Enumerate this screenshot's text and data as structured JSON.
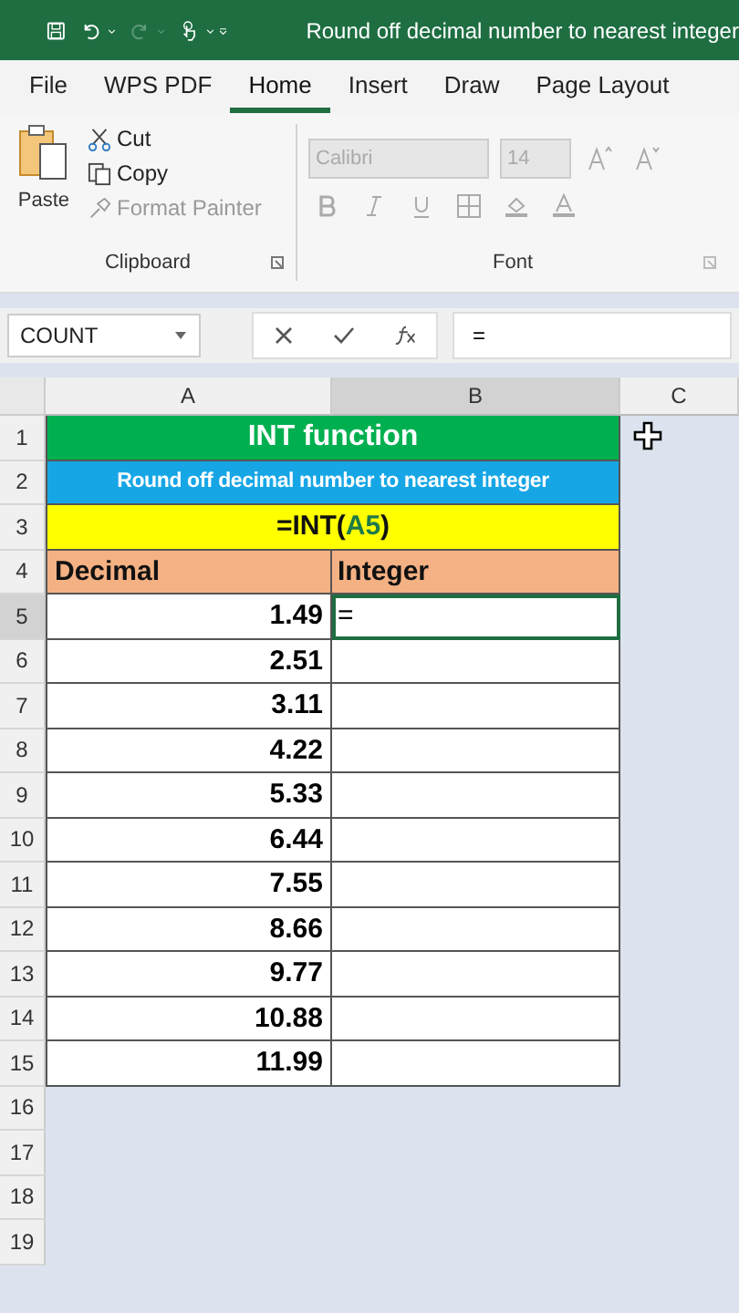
{
  "window": {
    "title": "Round off decimal number to nearest integer"
  },
  "tabs": [
    {
      "label": "File",
      "selected": false
    },
    {
      "label": "WPS PDF",
      "selected": false
    },
    {
      "label": "Home",
      "selected": true
    },
    {
      "label": "Insert",
      "selected": false
    },
    {
      "label": "Draw",
      "selected": false
    },
    {
      "label": "Page Layout",
      "selected": false
    }
  ],
  "clipboard": {
    "label": "Clipboard",
    "paste": "Paste",
    "items": [
      {
        "kind": "cut",
        "label": "Cut",
        "disabled": false
      },
      {
        "kind": "copy",
        "label": "Copy",
        "disabled": false
      },
      {
        "kind": "painter",
        "label": "Format Painter",
        "disabled": true
      }
    ]
  },
  "font": {
    "label": "Font",
    "family": "Calibri",
    "size": "14",
    "disabled": true
  },
  "formula_bar": {
    "name_box": "COUNT",
    "value": "="
  },
  "columns": [
    {
      "label": "A",
      "selected": false
    },
    {
      "label": "B",
      "selected": true
    },
    {
      "label": "C",
      "selected": false
    }
  ],
  "rows": [
    {
      "number": "1",
      "kind": "title",
      "text": "INT function"
    },
    {
      "number": "2",
      "kind": "subtitle",
      "text": "Round off decimal number to nearest integer"
    },
    {
      "number": "3",
      "kind": "formula",
      "before": "=INT(",
      "ref": "A5",
      "after": ")"
    },
    {
      "number": "4",
      "kind": "header",
      "a": "Decimal",
      "b": "Integer"
    },
    {
      "number": "5",
      "kind": "data",
      "a": "1.49",
      "b": "=",
      "active": true
    },
    {
      "number": "6",
      "kind": "data",
      "a": "2.51",
      "active": false
    },
    {
      "number": "7",
      "kind": "data",
      "a": "3.11",
      "active": false
    },
    {
      "number": "8",
      "kind": "data",
      "a": "4.22",
      "active": false
    },
    {
      "number": "9",
      "kind": "data",
      "a": "5.33",
      "active": false
    },
    {
      "number": "10",
      "kind": "data",
      "a": "6.44",
      "active": false
    },
    {
      "number": "11",
      "kind": "data",
      "a": "7.55",
      "active": false
    },
    {
      "number": "12",
      "kind": "data",
      "a": "8.66",
      "active": false
    },
    {
      "number": "13",
      "kind": "data",
      "a": "9.77",
      "active": false
    },
    {
      "number": "14",
      "kind": "data",
      "a": "10.88",
      "active": false
    },
    {
      "number": "15",
      "kind": "data",
      "a": "11.99",
      "active": false
    },
    {
      "number": "16",
      "kind": "empty"
    },
    {
      "number": "17",
      "kind": "empty"
    },
    {
      "number": "18",
      "kind": "empty"
    },
    {
      "number": "19",
      "kind": "empty"
    }
  ]
}
